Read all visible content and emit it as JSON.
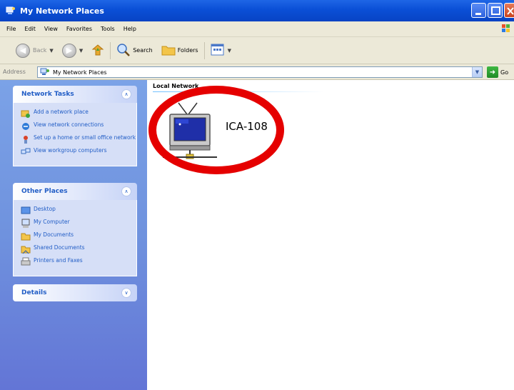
{
  "window": {
    "title": "My Network Places",
    "icon": "network-places-icon"
  },
  "menu": [
    "File",
    "Edit",
    "View",
    "Favorites",
    "Tools",
    "Help"
  ],
  "toolbar": {
    "back_label": "Back",
    "search_label": "Search",
    "folders_label": "Folders"
  },
  "address": {
    "label": "Address",
    "value": "My Network Places",
    "go_label": "Go"
  },
  "sidebar": {
    "network_tasks": {
      "title": "Network Tasks",
      "items": [
        {
          "label": "Add a network place",
          "icon": "add-network-place-icon"
        },
        {
          "label": "View network connections",
          "icon": "network-connections-icon"
        },
        {
          "label": "Set up a home or small office network",
          "icon": "home-network-setup-icon"
        },
        {
          "label": "View workgroup computers",
          "icon": "workgroup-computers-icon"
        }
      ]
    },
    "other_places": {
      "title": "Other Places",
      "items": [
        {
          "label": "Desktop",
          "icon": "desktop-icon"
        },
        {
          "label": "My Computer",
          "icon": "my-computer-icon"
        },
        {
          "label": "My Documents",
          "icon": "my-documents-icon"
        },
        {
          "label": "Shared Documents",
          "icon": "shared-documents-icon"
        },
        {
          "label": "Printers and Faxes",
          "icon": "printers-faxes-icon"
        }
      ]
    },
    "details": {
      "title": "Details"
    }
  },
  "content": {
    "group_header": "Local Network",
    "items": [
      {
        "label": "ICA-108",
        "icon": "network-device-icon"
      }
    ]
  },
  "colors": {
    "titlebar": "#0a4fd6",
    "sidebar": "#7ba2e7",
    "link": "#215dc6",
    "highlight": "#e50000"
  }
}
